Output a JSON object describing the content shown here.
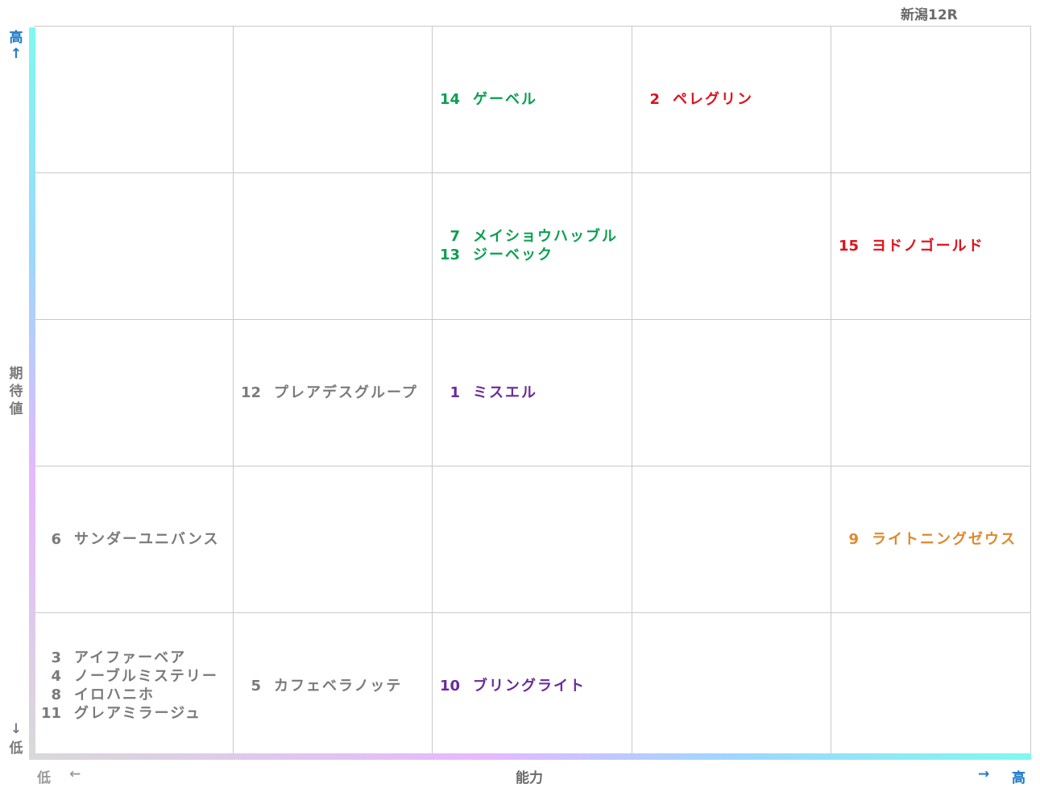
{
  "race_label": "新潟12R",
  "y_axis": {
    "label": "期待値",
    "high_label": "高",
    "low_label": "低",
    "up_arrow": "↑",
    "down_arrow": "↓"
  },
  "x_axis": {
    "label": "能力",
    "low_label": "低",
    "high_label": "高",
    "left_arrow": "←",
    "right_arrow": "→"
  },
  "colors": {
    "green": "#0aa050",
    "red": "#e0101c",
    "gray": "#7a7a7a",
    "purple": "#6a2b9a",
    "orange": "#e0882c"
  },
  "chart_data": {
    "type": "table",
    "columns": 5,
    "rows": 5,
    "x_axis": "能力",
    "y_axis": "期待値",
    "cells": [
      {
        "col": 3,
        "row": 1,
        "color": "green",
        "horses": [
          {
            "num": "14",
            "name": "ゲーベル"
          }
        ]
      },
      {
        "col": 4,
        "row": 1,
        "color": "red",
        "horses": [
          {
            "num": "2",
            "name": "ペレグリン"
          }
        ]
      },
      {
        "col": 3,
        "row": 2,
        "color": "green",
        "horses": [
          {
            "num": "7",
            "name": "メイショウハッブル"
          },
          {
            "num": "13",
            "name": "ジーベック"
          }
        ]
      },
      {
        "col": 5,
        "row": 2,
        "color": "red",
        "horses": [
          {
            "num": "15",
            "name": "ヨドノゴールド"
          }
        ]
      },
      {
        "col": 2,
        "row": 3,
        "color": "gray",
        "horses": [
          {
            "num": "12",
            "name": "プレアデスグループ"
          }
        ]
      },
      {
        "col": 3,
        "row": 3,
        "color": "purple",
        "horses": [
          {
            "num": "1",
            "name": "ミスエル"
          }
        ]
      },
      {
        "col": 1,
        "row": 4,
        "color": "gray",
        "horses": [
          {
            "num": "6",
            "name": "サンダーユニバンス"
          }
        ]
      },
      {
        "col": 5,
        "row": 4,
        "color": "orange",
        "horses": [
          {
            "num": "9",
            "name": "ライトニングゼウス"
          }
        ]
      },
      {
        "col": 1,
        "row": 5,
        "color": "gray",
        "horses": [
          {
            "num": "3",
            "name": "アイファーベア"
          },
          {
            "num": "4",
            "name": "ノーブルミステリー"
          },
          {
            "num": "8",
            "name": "イロハニホ"
          },
          {
            "num": "11",
            "name": "グレアミラージュ"
          }
        ]
      },
      {
        "col": 2,
        "row": 5,
        "color": "gray",
        "horses": [
          {
            "num": "5",
            "name": "カフェベラノッテ"
          }
        ]
      },
      {
        "col": 3,
        "row": 5,
        "color": "purple",
        "horses": [
          {
            "num": "10",
            "name": "ブリングライト"
          }
        ]
      }
    ]
  }
}
